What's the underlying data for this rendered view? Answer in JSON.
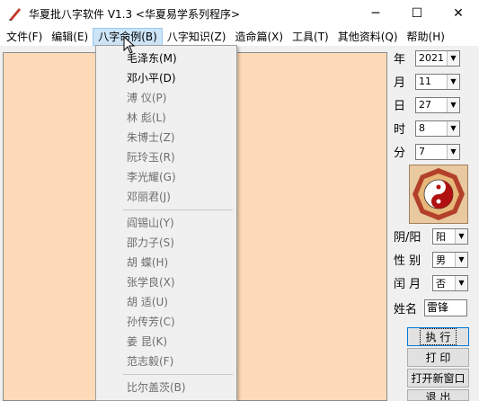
{
  "window": {
    "title": "华夏批八字软件 V1.3   <华夏易学系列程序>",
    "minimize": "─",
    "maximize": "☐",
    "close": "✕"
  },
  "menubar": {
    "items": [
      "文件(F)",
      "编辑(E)",
      "八字命例(B)",
      "八字知识(Z)",
      "造命篇(X)",
      "工具(T)",
      "其他资料(Q)",
      "帮助(H)"
    ]
  },
  "dropdown": {
    "group1": [
      "毛泽东(M)",
      "邓小平(D)",
      "溥  仪(P)",
      "林  彪(L)",
      "朱博士(Z)",
      "阮玲玉(R)",
      "李光耀(G)",
      "邓丽君(J)"
    ],
    "group2": [
      "阎锡山(Y)",
      "邵力子(S)",
      "胡  蝶(H)",
      "张学良(X)",
      "胡  适(U)",
      "孙传芳(C)",
      "姜  昆(K)",
      "范志毅(F)"
    ],
    "group3": [
      "比尔盖茨(B)"
    ]
  },
  "panel": {
    "year_label": "年",
    "year": "2021",
    "month_label": "月",
    "month": "11",
    "day_label": "日",
    "day": "27",
    "hour_label": "时",
    "hour": "8",
    "minute_label": "分",
    "minute": "7",
    "yinyang_label": "阴/阳",
    "yinyang": "阳",
    "gender_label": "性 别",
    "gender": "男",
    "leap_label": "闰 月",
    "leap": "否",
    "name_label": "姓名",
    "name": "雷锋",
    "btn_execute": "执 行",
    "btn_print": "打 印",
    "btn_new_window": "打开新窗口",
    "btn_exit": "退 出"
  }
}
